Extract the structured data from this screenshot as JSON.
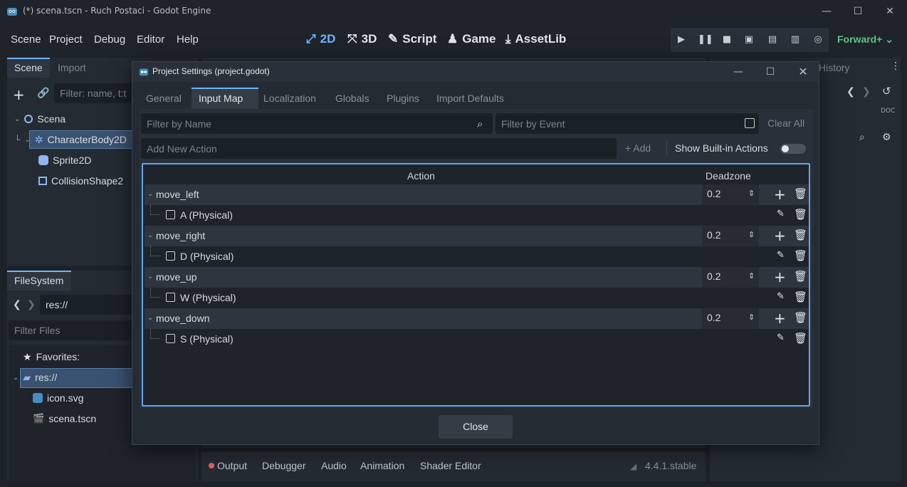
{
  "window": {
    "title": "(*) scena.tscn - Ruch Postaci - Godot Engine",
    "controls": [
      "—",
      "☐",
      "✕"
    ]
  },
  "menu": [
    "Scene",
    "Project",
    "Debug",
    "Editor",
    "Help"
  ],
  "workspaces": [
    {
      "label": "2D",
      "icon": "2d-icon",
      "active": true
    },
    {
      "label": "3D",
      "icon": "3d-icon",
      "active": false
    },
    {
      "label": "Script",
      "icon": "script-icon",
      "active": false
    },
    {
      "label": "Game",
      "icon": "game-icon",
      "active": false
    },
    {
      "label": "AssetLib",
      "icon": "assetlib-icon",
      "active": false
    }
  ],
  "renderer": "Forward+",
  "scene_dock": {
    "tabs": [
      "Scene",
      "Import"
    ],
    "filter_placeholder": "Filter: name, t:t",
    "tree": [
      {
        "label": "Scena",
        "icon": "node2d-icon"
      },
      {
        "label": "CharacterBody2D",
        "icon": "characterbody-icon"
      },
      {
        "label": "Sprite2D",
        "icon": "sprite-icon"
      },
      {
        "label": "CollisionShape2",
        "icon": "collision-icon"
      }
    ]
  },
  "filesystem_dock": {
    "tab": "FileSystem",
    "path": "res://",
    "filter_placeholder": "Filter Files",
    "favorites": "Favorites:",
    "items": [
      {
        "label": "res://",
        "icon": "folder-icon"
      },
      {
        "label": "icon.svg",
        "icon": "svg-icon"
      },
      {
        "label": "scena.tscn",
        "icon": "scene-file-icon"
      }
    ]
  },
  "right_dock": {
    "tab": "History"
  },
  "bottom_panel": {
    "tabs": [
      "Output",
      "Debugger",
      "Audio",
      "Animation",
      "Shader Editor"
    ],
    "version": "4.4.1.stable"
  },
  "dialog": {
    "title": "Project Settings (project.godot)",
    "tabs": [
      "General",
      "Input Map",
      "Localization",
      "Globals",
      "Plugins",
      "Import Defaults"
    ],
    "active_tab": "Input Map",
    "filter_name_placeholder": "Filter by Name",
    "filter_event_placeholder": "Filter by Event",
    "clear_all": "Clear All",
    "add_action_placeholder": "Add New Action",
    "add_button": "Add",
    "show_builtin": "Show Built-in Actions",
    "columns": {
      "action": "Action",
      "deadzone": "Deadzone"
    },
    "actions": [
      {
        "name": "move_left",
        "deadzone": "0.2",
        "event": "A (Physical)"
      },
      {
        "name": "move_right",
        "deadzone": "0.2",
        "event": "D (Physical)"
      },
      {
        "name": "move_up",
        "deadzone": "0.2",
        "event": "W (Physical)"
      },
      {
        "name": "move_down",
        "deadzone": "0.2",
        "event": "S (Physical)"
      }
    ],
    "close_button": "Close"
  }
}
